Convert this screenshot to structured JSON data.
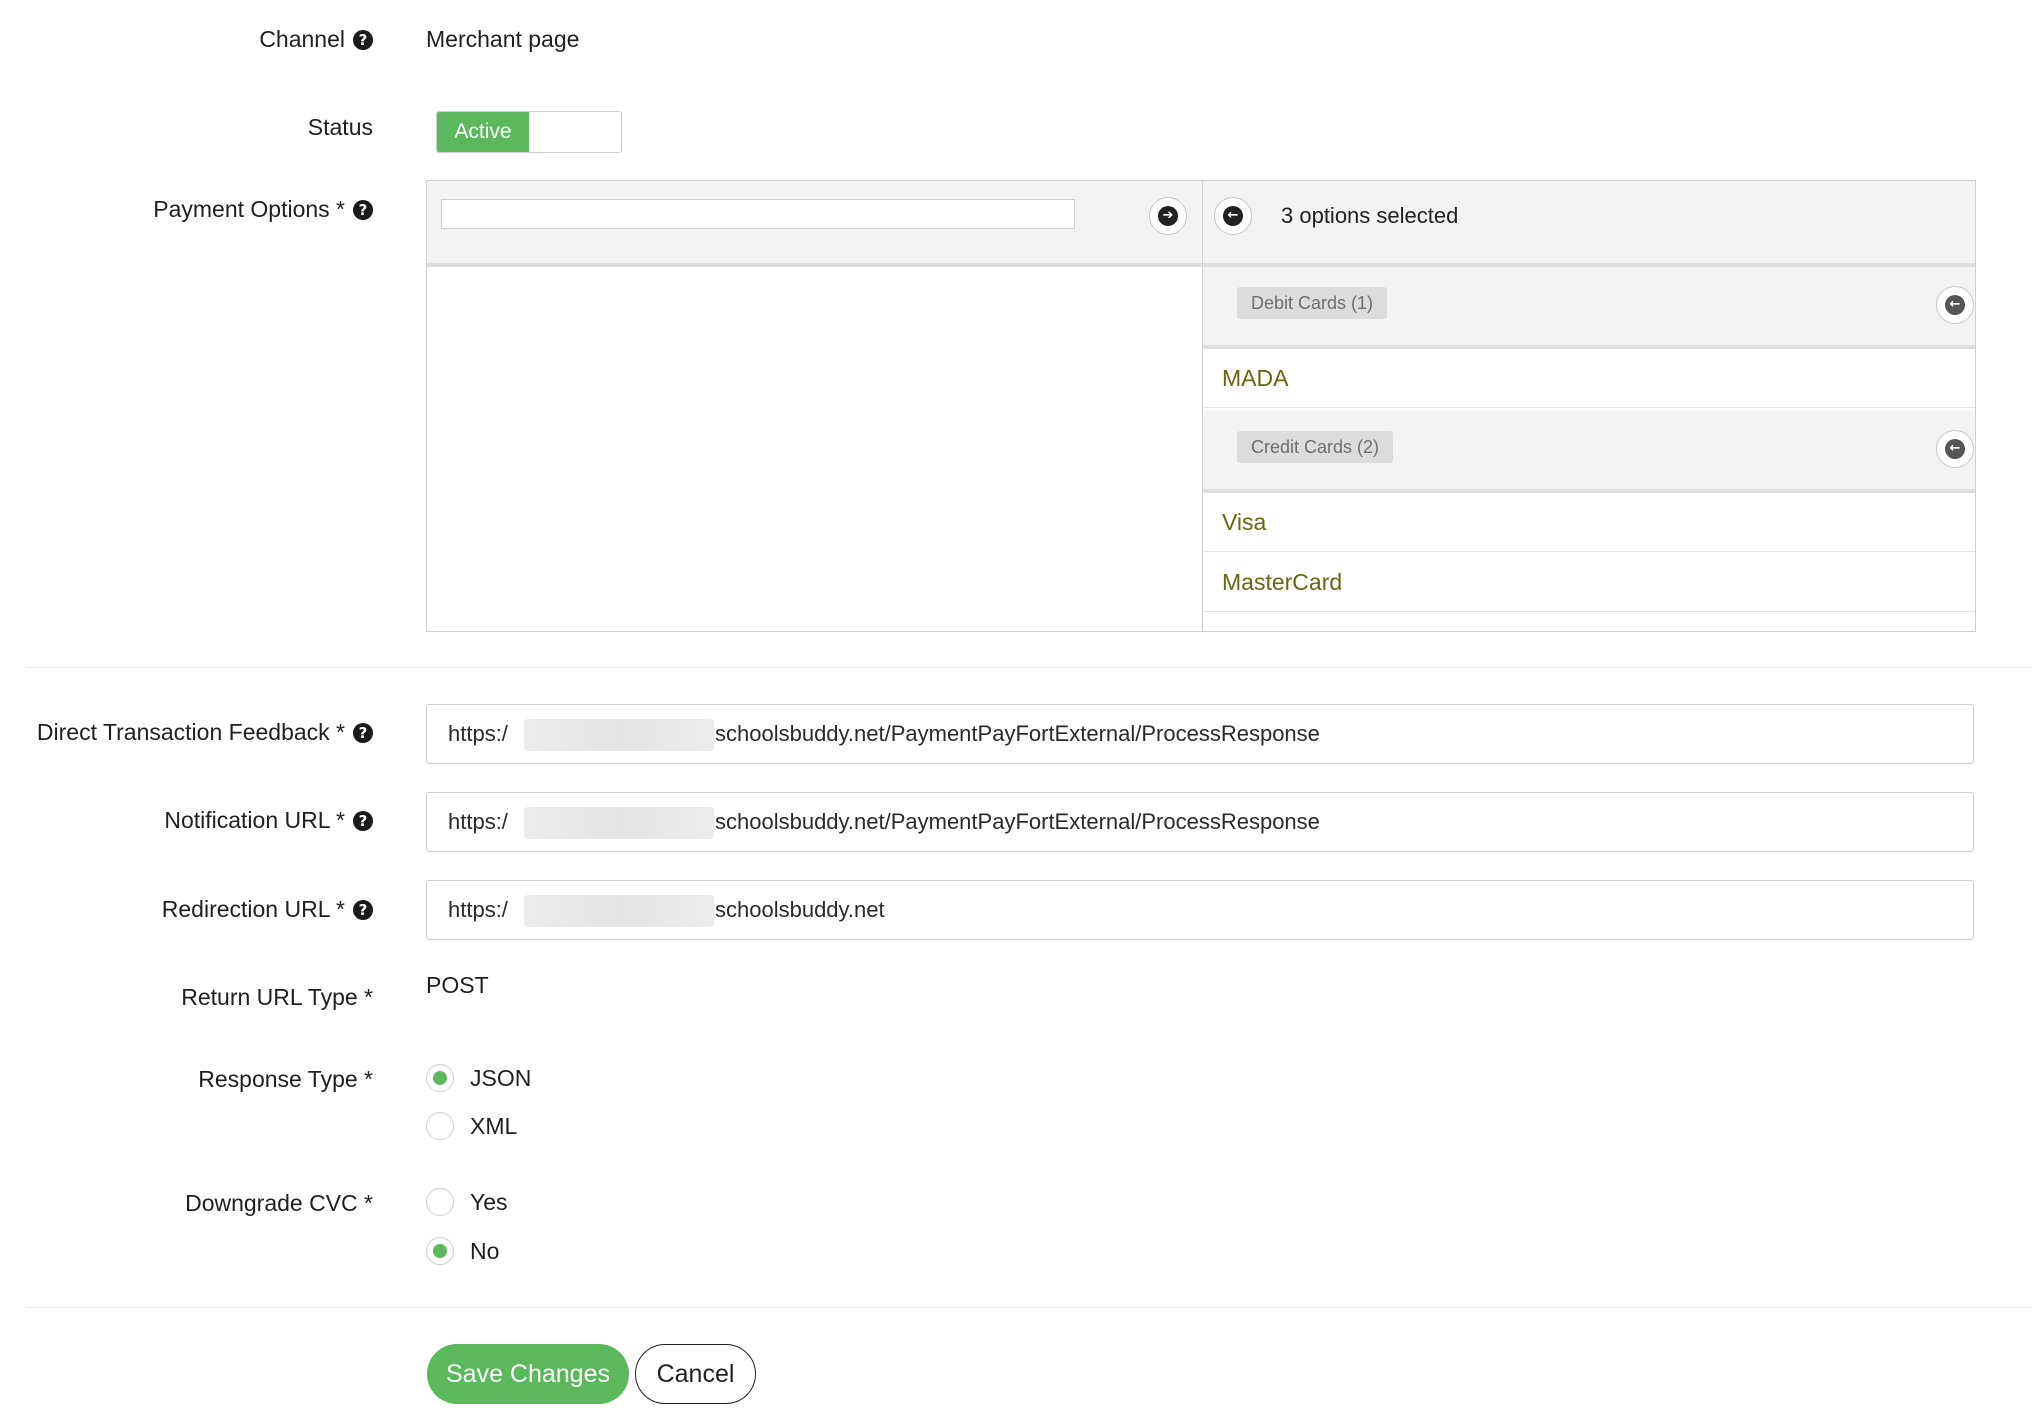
{
  "channel": {
    "label": "Channel",
    "value": "Merchant page"
  },
  "status": {
    "label": "Status",
    "toggle_label": "Active",
    "active": true
  },
  "payment_options": {
    "label": "Payment Options *",
    "search_value": "",
    "selected_count_text": "3 options selected",
    "groups": [
      {
        "name": "Debit Cards (1)",
        "options": [
          "MADA"
        ]
      },
      {
        "name": "Credit Cards (2)",
        "options": [
          "Visa",
          "MasterCard"
        ]
      }
    ]
  },
  "direct_feedback": {
    "label": "Direct Transaction Feedback *",
    "prefix": "https:/",
    "suffix": "schoolsbuddy.net/PaymentPayFortExternal/ProcessResponse"
  },
  "notification_url": {
    "label": "Notification URL *",
    "prefix": "https:/",
    "suffix": "schoolsbuddy.net/PaymentPayFortExternal/ProcessResponse"
  },
  "redirection_url": {
    "label": "Redirection URL *",
    "prefix": "https:/",
    "suffix": "schoolsbuddy.net"
  },
  "return_url_type": {
    "label": "Return URL Type *",
    "value": "POST"
  },
  "response_type": {
    "label": "Response Type *",
    "options": [
      {
        "label": "JSON",
        "selected": true
      },
      {
        "label": "XML",
        "selected": false
      }
    ]
  },
  "downgrade_cvc": {
    "label": "Downgrade CVC *",
    "options": [
      {
        "label": "Yes",
        "selected": false
      },
      {
        "label": "No",
        "selected": true
      }
    ]
  },
  "actions": {
    "save_label": "Save Changes",
    "cancel_label": "Cancel"
  },
  "colors": {
    "accent": "#5cb85c",
    "option_text": "#6b6410",
    "badge_bg": "#dcdcdc"
  },
  "icons": {
    "help": "question-circle-icon",
    "move_right": "arrow-right-circle-icon",
    "move_left": "arrow-left-circle-icon"
  }
}
